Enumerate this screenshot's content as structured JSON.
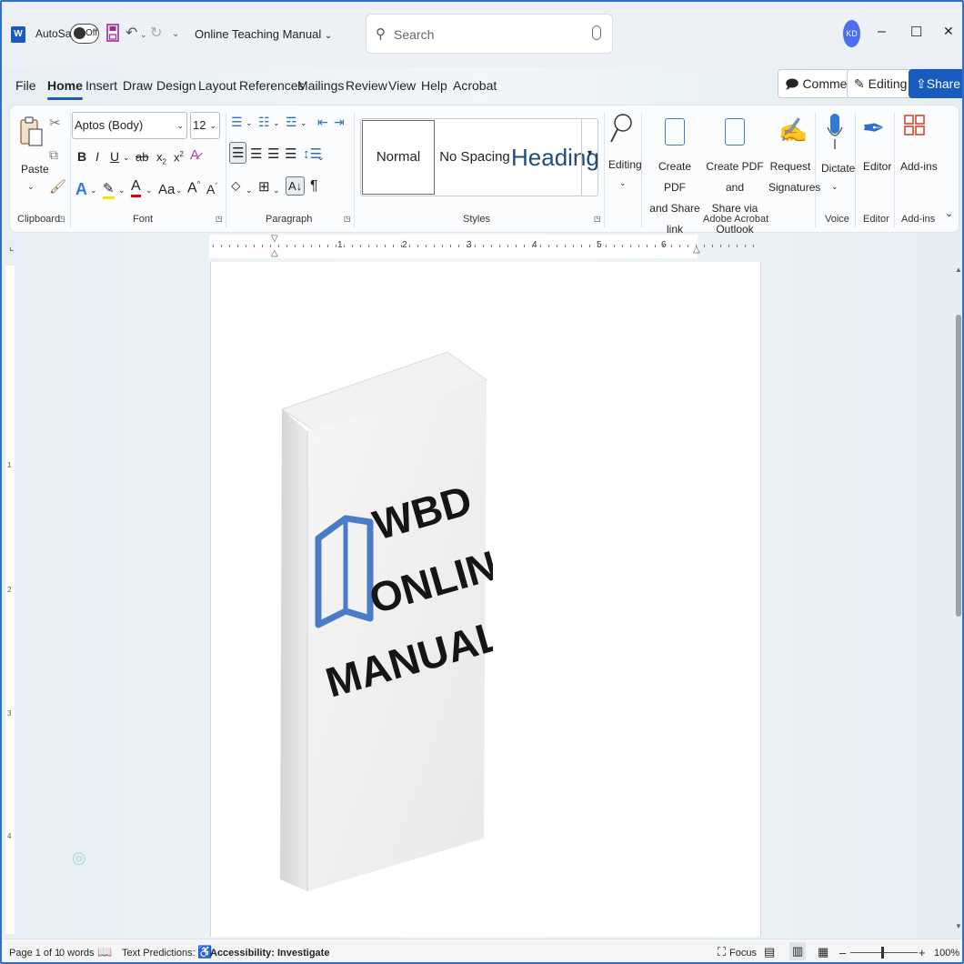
{
  "titlebar": {
    "app_icon": "W",
    "autosave_label": "AutoSave",
    "autosave_state": "Off",
    "doc_title": "Online Teaching Manual",
    "search_placeholder": "Search",
    "avatar_initials": "KD",
    "win_minimize": "–",
    "win_restore": "☐",
    "win_close": "✕"
  },
  "tabs": [
    "File",
    "Home",
    "Insert",
    "Draw",
    "Design",
    "Layout",
    "References",
    "Mailings",
    "Review",
    "View",
    "Help",
    "Acrobat"
  ],
  "right_buttons": {
    "comments": "Comments",
    "editing": "Editing",
    "share": "Share"
  },
  "ribbon": {
    "clipboard": {
      "paste": "Paste",
      "label": "Clipboard"
    },
    "font": {
      "name": "Aptos (Body)",
      "size": "12",
      "label": "Font",
      "bold": "B",
      "italic": "I",
      "underline": "U",
      "strike": "ab",
      "subscript": "x",
      "superscript": "x",
      "aa": "Aa",
      "grow": "A",
      "shrink": "A"
    },
    "paragraph": {
      "label": "Paragraph"
    },
    "styles": {
      "normal": "Normal",
      "no_spacing": "No Spacing",
      "heading": "Heading",
      "label": "Styles"
    },
    "editing": {
      "label": "Editing"
    },
    "acrobat": {
      "create_pdf_1": "Create PDF",
      "create_pdf_2": "and Share link",
      "create_outlook_1": "Create PDF and",
      "create_outlook_2": "Share via Outlook",
      "request_1": "Request",
      "request_2": "Signatures",
      "label": "Adobe Acrobat"
    },
    "voice": {
      "dictate": "Dictate",
      "label": "Voice"
    },
    "editor": {
      "editor": "Editor",
      "label": "Editor"
    },
    "addins": {
      "addins": "Add-ins",
      "label": "Add-ins"
    }
  },
  "ruler": [
    "1",
    "2",
    "3",
    "4",
    "5",
    "6"
  ],
  "vruler": [
    "1",
    "2",
    "3",
    "4"
  ],
  "book": {
    "line1": "WBD",
    "line2": "ONLINE",
    "line3": "MANUALS",
    "logo_color": "#4a7bc8"
  },
  "status": {
    "page": "Page 1 of 1",
    "words": "0 words",
    "predictions": "Text Predictions: On",
    "accessibility": "Accessibility: Investigate",
    "focus": "Focus",
    "zoom": "100%"
  }
}
